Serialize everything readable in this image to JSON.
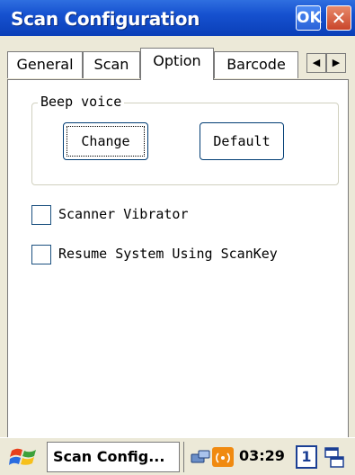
{
  "window": {
    "title": "Scan Configuration",
    "ok_label": "OK",
    "close_label": "✕"
  },
  "tabs": [
    {
      "label": "General"
    },
    {
      "label": "Scan"
    },
    {
      "label": "Option",
      "active": true
    },
    {
      "label": "Barcode"
    }
  ],
  "tab_scroll": {
    "left_icon": "◀",
    "right_icon": "▶"
  },
  "beep_group": {
    "label": "Beep voice",
    "change_label": "Change",
    "default_label": "Default"
  },
  "options": [
    {
      "label": "Scanner Vibrator",
      "checked": false
    },
    {
      "label": "Resume System Using ScanKey",
      "checked": false
    }
  ],
  "taskbar": {
    "task_label": "Scan Config...",
    "clock": "03:29",
    "input_badge": "1"
  },
  "colors": {
    "title_bar": "#1651d0",
    "ok_button": "#2a62d8",
    "close_button": "#c9452a",
    "signal_icon": "#f08a10"
  }
}
